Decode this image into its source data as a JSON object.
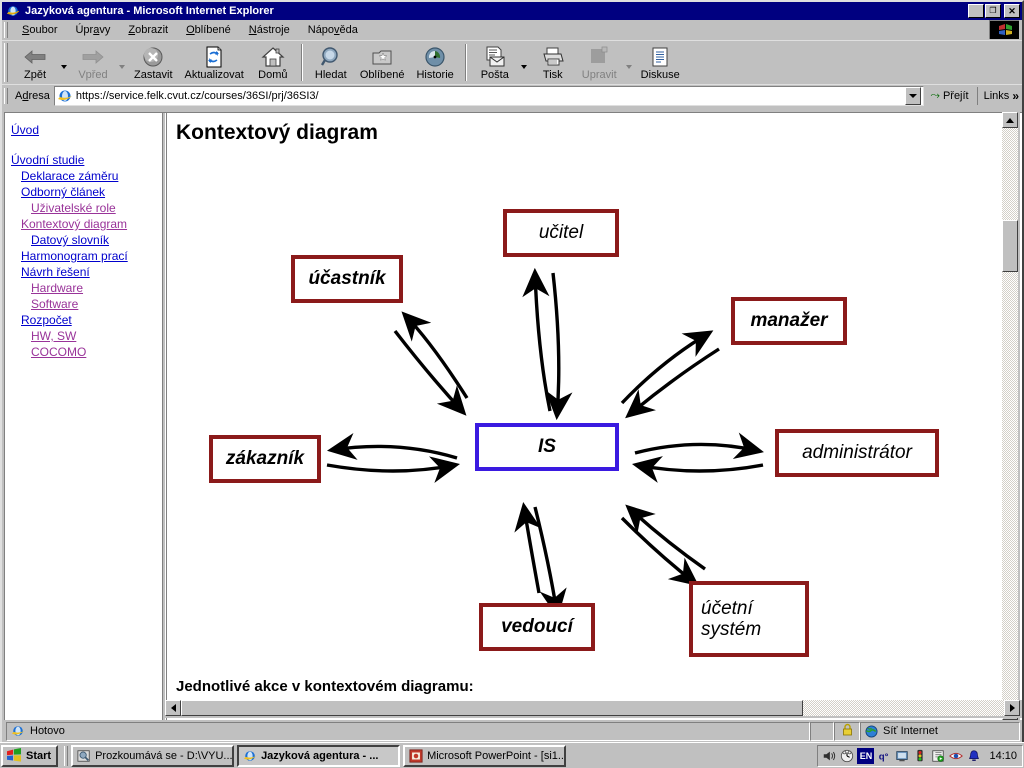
{
  "window": {
    "title": "Jazyková agentura - Microsoft Internet Explorer",
    "minimize_label": "_",
    "maximize_label": "❐",
    "close_label": "✕"
  },
  "menubar": {
    "items": [
      {
        "label": "Soubor",
        "accel": "S"
      },
      {
        "label": "Úpravy",
        "accel": "a"
      },
      {
        "label": "Zobrazit",
        "accel": "Z"
      },
      {
        "label": "Oblíbené",
        "accel": "O"
      },
      {
        "label": "Nástroje",
        "accel": "N"
      },
      {
        "label": "Nápověda",
        "accel": "v"
      }
    ]
  },
  "toolbar": {
    "buttons": [
      {
        "label": "Zpět",
        "icon": "back-arrow-icon",
        "disabled": false,
        "dropdown": true
      },
      {
        "label": "Vpřed",
        "icon": "forward-arrow-icon",
        "disabled": true,
        "dropdown": true
      },
      {
        "label": "Zastavit",
        "icon": "stop-icon",
        "disabled": false,
        "dropdown": false
      },
      {
        "label": "Aktualizovat",
        "icon": "refresh-icon",
        "disabled": false,
        "dropdown": false
      },
      {
        "label": "Domů",
        "icon": "home-icon",
        "disabled": false,
        "dropdown": false
      },
      {
        "label": "Hledat",
        "icon": "search-icon",
        "disabled": false,
        "dropdown": false
      },
      {
        "label": "Oblíbené",
        "icon": "favorites-star-icon",
        "disabled": false,
        "dropdown": false
      },
      {
        "label": "Historie",
        "icon": "history-clock-icon",
        "disabled": false,
        "dropdown": false
      },
      {
        "label": "Pošta",
        "icon": "mail-icon",
        "disabled": false,
        "dropdown": true
      },
      {
        "label": "Tisk",
        "icon": "printer-icon",
        "disabled": false,
        "dropdown": false
      },
      {
        "label": "Upravit",
        "icon": "edit-icon",
        "disabled": true,
        "dropdown": true
      },
      {
        "label": "Diskuse",
        "icon": "discuss-icon",
        "disabled": false,
        "dropdown": false
      }
    ]
  },
  "address": {
    "label": "Adresa",
    "value": "https://service.felk.cvut.cz/courses/36SI/prj/36SI3/",
    "placeholder": "",
    "go_label": "Přejít",
    "links_label": "Links"
  },
  "sidebar": {
    "items": [
      {
        "label": "Úvod",
        "level": 0,
        "state": "unvisited"
      },
      {
        "label": "",
        "level": 0,
        "state": "gap"
      },
      {
        "label": "Úvodní studie",
        "level": 0,
        "state": "unvisited"
      },
      {
        "label": "Deklarace záměru",
        "level": 1,
        "state": "unvisited"
      },
      {
        "label": "Odborný článek",
        "level": 1,
        "state": "unvisited"
      },
      {
        "label": "Uživatelské role",
        "level": 2,
        "state": "visited"
      },
      {
        "label": "Kontextový diagram",
        "level": 1,
        "state": "visited"
      },
      {
        "label": "Datový slovník",
        "level": 2,
        "state": "unvisited"
      },
      {
        "label": "Harmonogram prací",
        "level": 1,
        "state": "unvisited"
      },
      {
        "label": "Návrh řešení",
        "level": 1,
        "state": "unvisited"
      },
      {
        "label": "Hardware",
        "level": 2,
        "state": "visited"
      },
      {
        "label": "Software",
        "level": 2,
        "state": "visited"
      },
      {
        "label": "Rozpočet",
        "level": 1,
        "state": "unvisited"
      },
      {
        "label": "HW, SW",
        "level": 2,
        "state": "visited"
      },
      {
        "label": "COCOMO",
        "level": 2,
        "state": "visited"
      }
    ]
  },
  "content": {
    "title": "Kontextový diagram",
    "subtitle": "Jednotlivé akce v kontextovém diagramu:"
  },
  "diagram": {
    "entity_border_color": "#8b1a1a",
    "center_border_color": "#3a1ae0",
    "center": {
      "label": "IS"
    },
    "entities": [
      {
        "label": "učitel"
      },
      {
        "label": "účastník"
      },
      {
        "label": "manažer"
      },
      {
        "label": "zákazník"
      },
      {
        "label": "administrátor"
      },
      {
        "label": "vedoucí"
      },
      {
        "label": "účetní systém"
      }
    ]
  },
  "statusbar": {
    "text": "Hotovo",
    "zone": "Síť Internet",
    "lock_icon": "padlock-icon"
  },
  "taskbar": {
    "start_label": "Start",
    "tasks": [
      {
        "label": "Prozkoumává se - D:\\VYU...",
        "icon": "explorer-icon",
        "active": false
      },
      {
        "label": "Jazyková agentura - ...",
        "icon": "ie-icon",
        "active": true
      },
      {
        "label": "Microsoft PowerPoint - [si1...",
        "icon": "powerpoint-icon",
        "active": false
      }
    ],
    "tray_icons": [
      "volume-icon",
      "scheduler-icon",
      "language-EN-icon",
      "keyboard-icon",
      "display-icon",
      "traffic-light-icon",
      "media-icon",
      "eye-icon",
      "bell-icon"
    ],
    "language": "EN",
    "clock": "14:10"
  }
}
